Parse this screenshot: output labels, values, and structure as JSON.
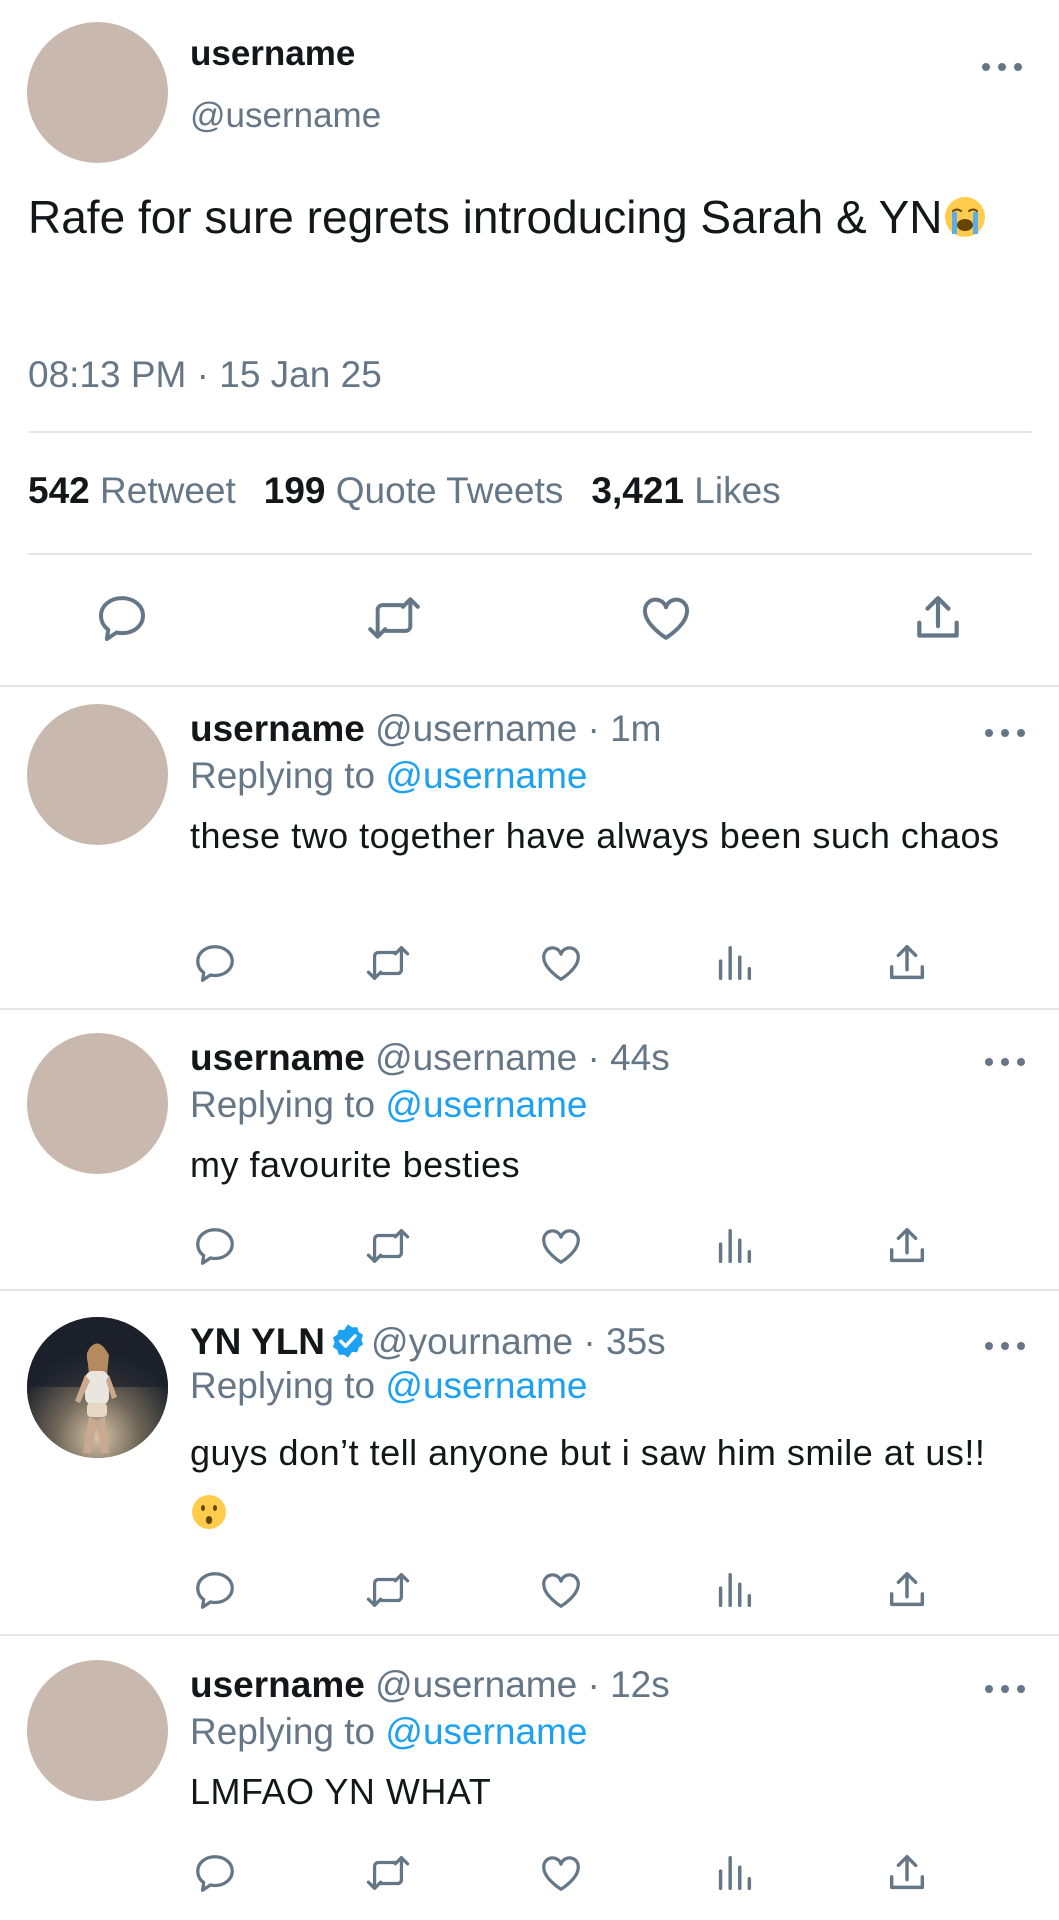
{
  "main_tweet": {
    "display_name": "username",
    "handle": "@username",
    "text": "Rafe for sure regrets introducing Sarah & YN",
    "text_emoji": "loudly-crying-face-emoji",
    "timestamp": "08:13 PM · 15 Jan 25",
    "stats": {
      "retweets_count": "542",
      "retweets_label": "Retweet",
      "quotes_count": "199",
      "quotes_label": "Quote Tweets",
      "likes_count": "3,421",
      "likes_label": "Likes"
    },
    "actions": [
      "reply-icon",
      "retweet-icon",
      "like-icon",
      "share-icon"
    ]
  },
  "replies": [
    {
      "display_name": "username",
      "meta": "@username · 1m",
      "replying_prefix": "Replying to",
      "replying_to": "@username",
      "text": "these two together have always been such chaos",
      "verified": false
    },
    {
      "display_name": "username",
      "meta": "@username · 44s",
      "replying_prefix": "Replying to",
      "replying_to": "@username",
      "text": "my favourite besties",
      "verified": false
    },
    {
      "display_name": "YN YLN",
      "meta": "@yourname · 35s",
      "replying_prefix": "Replying to",
      "replying_to": "@username",
      "text": "guys don’t tell anyone but i saw him smile at us!!",
      "text_emoji": "hushed-face-emoji",
      "verified": true,
      "avatar": "profile-photo"
    },
    {
      "display_name": "username",
      "meta": "@username · 12s",
      "replying_prefix": "Replying to",
      "replying_to": "@username",
      "text": "LMFAO YN WHAT",
      "verified": false
    }
  ],
  "reply_actions": [
    "reply-icon",
    "retweet-icon",
    "like-icon",
    "analytics-icon",
    "share-icon"
  ],
  "colors": {
    "text_primary": "#14171a",
    "text_secondary": "#657786",
    "accent": "#1da1f2",
    "avatar_placeholder": "#c8b8ad",
    "divider": "#e1e8ed"
  }
}
